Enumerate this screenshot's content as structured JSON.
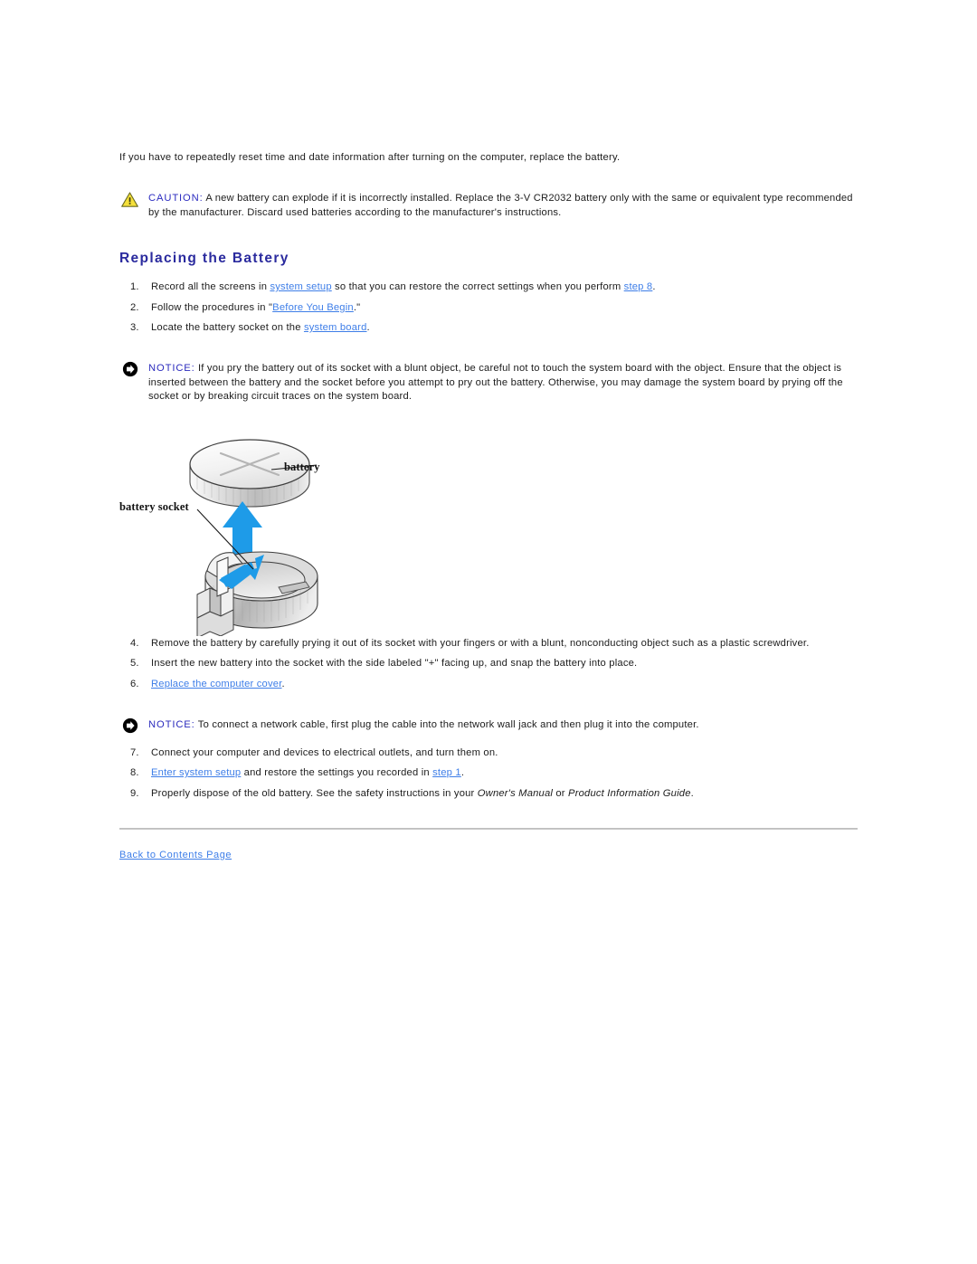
{
  "page": {
    "intro_paragraph": "If you have to repeatedly reset time and date information after turning on the computer, replace the battery.",
    "section_title": "Replacing the Battery"
  },
  "caution": {
    "icon": "warning-triangle-icon",
    "keyword": "CAUTION:",
    "text": " A new battery can explode if it is incorrectly installed. Replace the 3-V CR2032 battery only with the same or equivalent type recommended by the manufacturer. Discard used batteries according to the manufacturer's instructions."
  },
  "notice_1": {
    "icon": "notice-arrow-icon",
    "keyword": "NOTICE:",
    "text": " If you pry the battery out of its socket with a blunt object, be careful not to touch the system board with the object. Ensure that the object is inserted between the battery and the socket before you attempt to pry out the battery. Otherwise, you may damage the system board by prying off the socket or by breaking circuit traces on the system board."
  },
  "notice_2": {
    "icon": "notice-arrow-icon",
    "keyword": "NOTICE:",
    "text": " To connect a network cable, first plug the cable into the network wall jack and then plug it into the computer."
  },
  "steps_before": [
    {
      "num": "1.",
      "parts": [
        {
          "t": "Record all the screens in ",
          "link": false
        },
        {
          "t": "system setup",
          "link": true
        },
        {
          "t": " so that you can restore the correct settings when you perform ",
          "link": false
        },
        {
          "t": "step 8",
          "link": true
        },
        {
          "t": ".",
          "link": false
        }
      ]
    },
    {
      "num": "2.",
      "parts": [
        {
          "t": "Follow the procedures in \"",
          "link": false
        },
        {
          "t": "Before You Begin",
          "link": true
        },
        {
          "t": ".\"",
          "link": false
        }
      ]
    },
    {
      "num": "3.",
      "parts": [
        {
          "t": "Locate the battery socket on the ",
          "link": false
        },
        {
          "t": "system board",
          "link": true
        },
        {
          "t": ".",
          "link": false
        }
      ]
    }
  ],
  "steps_middle": [
    {
      "num": "4.",
      "parts": [
        {
          "t": "Remove the battery by carefully prying it out of its socket with your fingers or with a blunt, nonconducting object such as a plastic screwdriver.",
          "link": false
        }
      ]
    },
    {
      "num": "5.",
      "parts": [
        {
          "t": "Insert the new battery into the socket with the side labeled \"+\" facing up, and snap the battery into place.",
          "link": false
        }
      ]
    },
    {
      "num": "6.",
      "parts": [
        {
          "t": "Replace the computer cover",
          "link": true
        },
        {
          "t": ".",
          "link": false
        }
      ]
    }
  ],
  "steps_after": [
    {
      "num": "7.",
      "parts": [
        {
          "t": "Connect your computer and devices to electrical outlets, and turn them on.",
          "link": false
        }
      ]
    },
    {
      "num": "8.",
      "parts": [
        {
          "t": "Enter system setup",
          "link": true
        },
        {
          "t": " and restore the settings you recorded in ",
          "link": false
        },
        {
          "t": "step 1",
          "link": true
        },
        {
          "t": ".",
          "link": false
        }
      ]
    },
    {
      "num": "9.",
      "parts": [
        {
          "t": "Properly dispose of the old battery. See the safety instructions in your ",
          "link": false
        },
        {
          "t": "Owner's Manual",
          "link": false,
          "italic": true
        },
        {
          "t": " or ",
          "link": false
        },
        {
          "t": "Product Information Guide",
          "link": false,
          "italic": true
        },
        {
          "t": ".",
          "link": false
        }
      ]
    }
  ],
  "figure": {
    "name": "battery-removal-diagram",
    "label_battery": "battery",
    "label_socket": "battery socket",
    "arrow_color": "#1E9BE8",
    "body_color": "#d9d9d9"
  },
  "footer": {
    "back_link": "Back to Contents Page"
  },
  "colors": {
    "link": "#3e7ee8",
    "heading": "#2a2a9e",
    "keyword": "#2c2cc0",
    "caution_fill": "#F5E03A",
    "text": "#1c1c1c"
  }
}
